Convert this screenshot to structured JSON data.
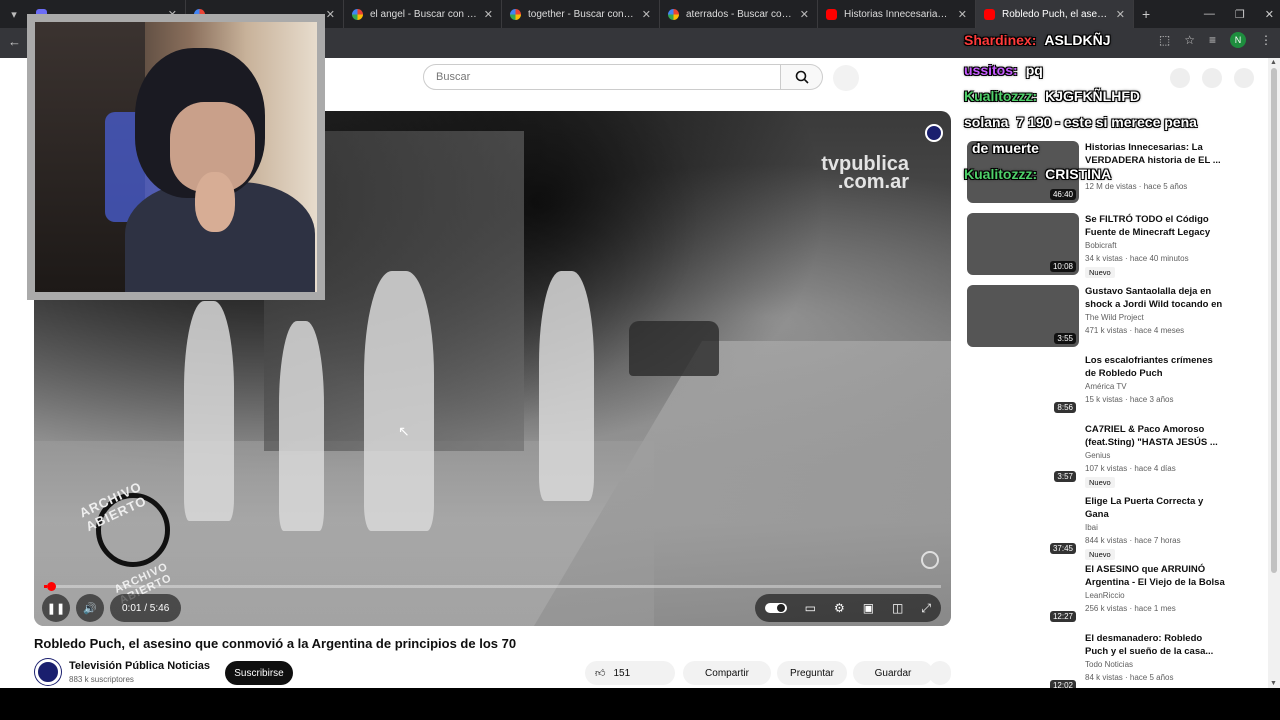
{
  "browser": {
    "tabs": [
      {
        "title": "",
        "type": "gh"
      },
      {
        "title": "",
        "type": "g"
      },
      {
        "title": "el angel - Buscar con Google",
        "type": "g"
      },
      {
        "title": "together - Buscar con Google",
        "type": "g"
      },
      {
        "title": "aterrados - Buscar con Google",
        "type": "g"
      },
      {
        "title": "Historias Innecesarias: La VERDA",
        "type": "yt"
      },
      {
        "title": "Robledo Puch, el asesino q",
        "type": "yt"
      }
    ],
    "profile_initial": "N"
  },
  "search": {
    "placeholder": "Buscar"
  },
  "player": {
    "watermark_line1": "tvpublica",
    "watermark_line2": ".com.ar",
    "archivo_top": "ARCHIVO ABIERTO",
    "archivo_bottom": "ARCHIVO ABIERTO",
    "time": "0:01 / 5:46",
    "progress": 0.003
  },
  "video": {
    "title": "Robledo Puch, el asesino que conmovió a la Argentina de principios de los 70",
    "channel": "Televisión Pública Noticias",
    "subscribers": "883 k suscriptores",
    "subscribe_label": "Suscribirse",
    "likes": "151",
    "share_label": "Compartir",
    "ask_label": "Preguntar",
    "save_label": "Guardar"
  },
  "recommendations": [
    {
      "title": "Historias Innecesarias: La VERDADERA historia de EL ...",
      "channel": "",
      "meta": "12 M de vistas · hace 5 años",
      "duration": "46:40",
      "badge": "",
      "thumb": "filled"
    },
    {
      "title": "Se FILTRÓ TODO el Código Fuente de Minecraft Legacy",
      "channel": "Bobicraft",
      "meta": "34 k vistas · hace 40 minutos",
      "duration": "10:08",
      "badge": "Nuevo",
      "thumb": "filled"
    },
    {
      "title": "Gustavo Santaolalla deja en shock a Jordi Wild tocando en ...",
      "channel": "The Wild Project",
      "meta": "471 k vistas · hace 4 meses",
      "duration": "3:55",
      "badge": "",
      "thumb": "filled"
    },
    {
      "title": "Los escalofriantes crímenes de Robledo Puch",
      "channel": "América TV",
      "meta": "15 k vistas · hace 3 años",
      "duration": "8:56",
      "badge": "",
      "thumb": ""
    },
    {
      "title": "CA7RIEL & Paco Amoroso (feat.Sting) \"HASTA JESÚS ...",
      "channel": "Genius",
      "meta": "107 k vistas · hace 4 días",
      "duration": "3:57",
      "badge": "Nuevo",
      "thumb": ""
    },
    {
      "title": "Elige La Puerta Correcta y Gana",
      "channel": "Ibai",
      "meta": "844 k vistas · hace 7 horas",
      "duration": "37:45",
      "badge": "Nuevo",
      "thumb": ""
    },
    {
      "title": "El ASESINO que ARRUINÓ Argentina - El Viejo de la Bolsa",
      "channel": "LeanRiccio",
      "meta": "256 k vistas · hace 1 mes",
      "duration": "12:27",
      "badge": "",
      "thumb": ""
    },
    {
      "title": "El desmanadero: Robledo Puch y el sueño de la casa... en la ...",
      "channel": "Todo Noticias",
      "meta": "84 k vistas · hace 5 años",
      "duration": "12:02",
      "badge": "",
      "thumb": ""
    }
  ],
  "chat": [
    {
      "user": "Shardinex:",
      "message": "ASLDKÑJ",
      "color": "#ff3b3b"
    },
    {
      "user": "ussitos:",
      "message": "pq",
      "color": "#c65bff"
    },
    {
      "user": "Kualitozzz:",
      "message": "KJGFKÑLHFD",
      "color": "#4fd16a"
    },
    {
      "user": "solana",
      "message": "7 190 - este si merece pena",
      "color": "#ffffff"
    },
    {
      "user": "",
      "message": "de muerte",
      "color": "#ffffff"
    },
    {
      "user": "Kualitozzz:",
      "message": "CRISTINA",
      "color": "#4fd16a"
    }
  ],
  "colors": {
    "accent": "#ff0000",
    "chrome_dark": "#202124"
  }
}
